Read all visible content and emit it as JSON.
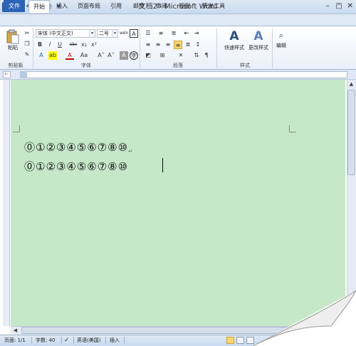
{
  "window": {
    "title": "文档2 - Microsoft Word",
    "app_icon": "W",
    "minimize": "–",
    "restore": "□",
    "close": "✕"
  },
  "qat": {
    "save_icon": "▣",
    "undo_icon": "↶",
    "redo_icon": "↷",
    "print_icon": "⎙",
    "customize_icon": "▾"
  },
  "tabs": [
    "文件",
    "开始",
    "插入",
    "页面布局",
    "引用",
    "邮件",
    "审阅",
    "视图",
    "开发工具"
  ],
  "tab_controls": {
    "minimize_ribbon": "^",
    "help": "?"
  },
  "ribbon": {
    "clipboard": {
      "paste_label": "粘贴",
      "group_label": "剪贴板"
    },
    "font": {
      "font_name": "宋体 (中文正文)",
      "font_size": "二号",
      "group_label": "字体",
      "bold": "B",
      "italic": "I",
      "underline": "U",
      "strike": "abc",
      "subscript": "x₂",
      "superscript": "x²",
      "grow": "A˄",
      "shrink": "A˅",
      "clear": "Aa",
      "phonetic": "wén",
      "border": "A",
      "enclose": "字",
      "highlight": "ab",
      "font_color": "A",
      "char_shade": "A",
      "change_case": "Aa"
    },
    "paragraph": {
      "group_label": "段落"
    },
    "styles": {
      "quick_styles": "快速样式",
      "change_styles": "更改样式",
      "group_label": "样式"
    },
    "editing": {
      "label": "编辑"
    }
  },
  "document": {
    "line1": "⓪①②③④⑤⑥⑦⑧⑩",
    "line2": "⓪①②③④⑤⑥⑦⑧⑩",
    "para_mark": "↵"
  },
  "statusbar": {
    "page": "页面: 1/1",
    "words": "字数: 40",
    "language": "英语(美国)",
    "mode": "插入"
  },
  "colors": {
    "page_background": "#c6e8c8",
    "file_tab": "#2b63b5",
    "ribbon_border": "#a3b7d3"
  }
}
